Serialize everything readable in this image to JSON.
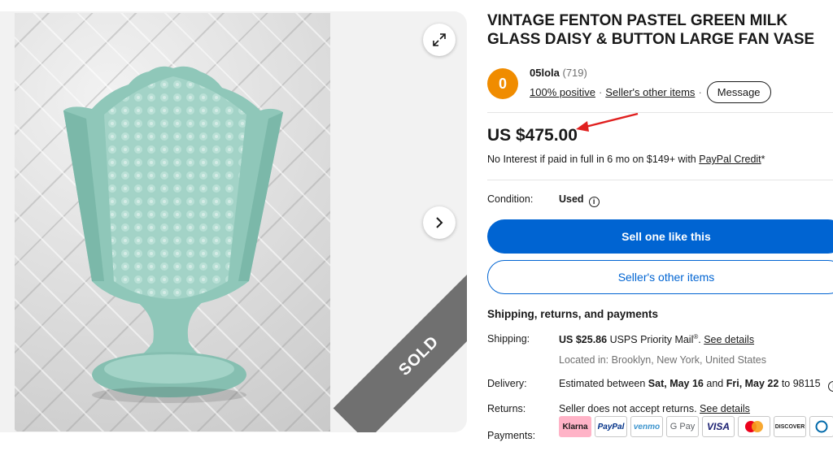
{
  "listing": {
    "title": "VINTAGE FENTON PASTEL GREEN MILK GLASS DAISY & BUTTON LARGE FAN VASE",
    "sold_label": "SOLD"
  },
  "seller": {
    "initial": "0",
    "name": "05lola",
    "feedback_count": "(719)",
    "positive": "100% positive",
    "other_items": "Seller's other items",
    "message_label": "Message"
  },
  "price": {
    "amount": "US $475.00",
    "financing_text": "No Interest if paid in full in 6 mo on $149+ with",
    "financing_link": "PayPal Credit",
    "financing_suffix": "*"
  },
  "condition": {
    "label": "Condition:",
    "value": "Used"
  },
  "buttons": {
    "sell_one": "Sell one like this",
    "seller_items": "Seller's other items"
  },
  "shipping": {
    "heading": "Shipping, returns, and payments",
    "shipping_label": "Shipping:",
    "shipping_price": "US $25.86",
    "shipping_service": "USPS Priority Mail",
    "shipping_reg": "®",
    "see_details": "See details",
    "location": "Located in: Brooklyn, New York, United States",
    "delivery_label": "Delivery:",
    "delivery_prefix": "Estimated between",
    "delivery_start": "Sat, May 16",
    "delivery_and": "and",
    "delivery_end": "Fri, May 22",
    "delivery_to": "to 98115",
    "returns_label": "Returns:",
    "returns_text": "Seller does not accept returns.",
    "returns_link": "See details",
    "payments_label": "Payments:"
  },
  "payments": [
    "Klarna",
    "PayPal",
    "venmo",
    "G Pay",
    "VISA",
    "Mastercard",
    "DISCOVER",
    "Diners"
  ],
  "colors": {
    "primary": "#0064d2",
    "avatar": "#f08c00",
    "vase": "#9fcfc3",
    "ribbon": "#707070",
    "arrow": "#e0201f"
  }
}
